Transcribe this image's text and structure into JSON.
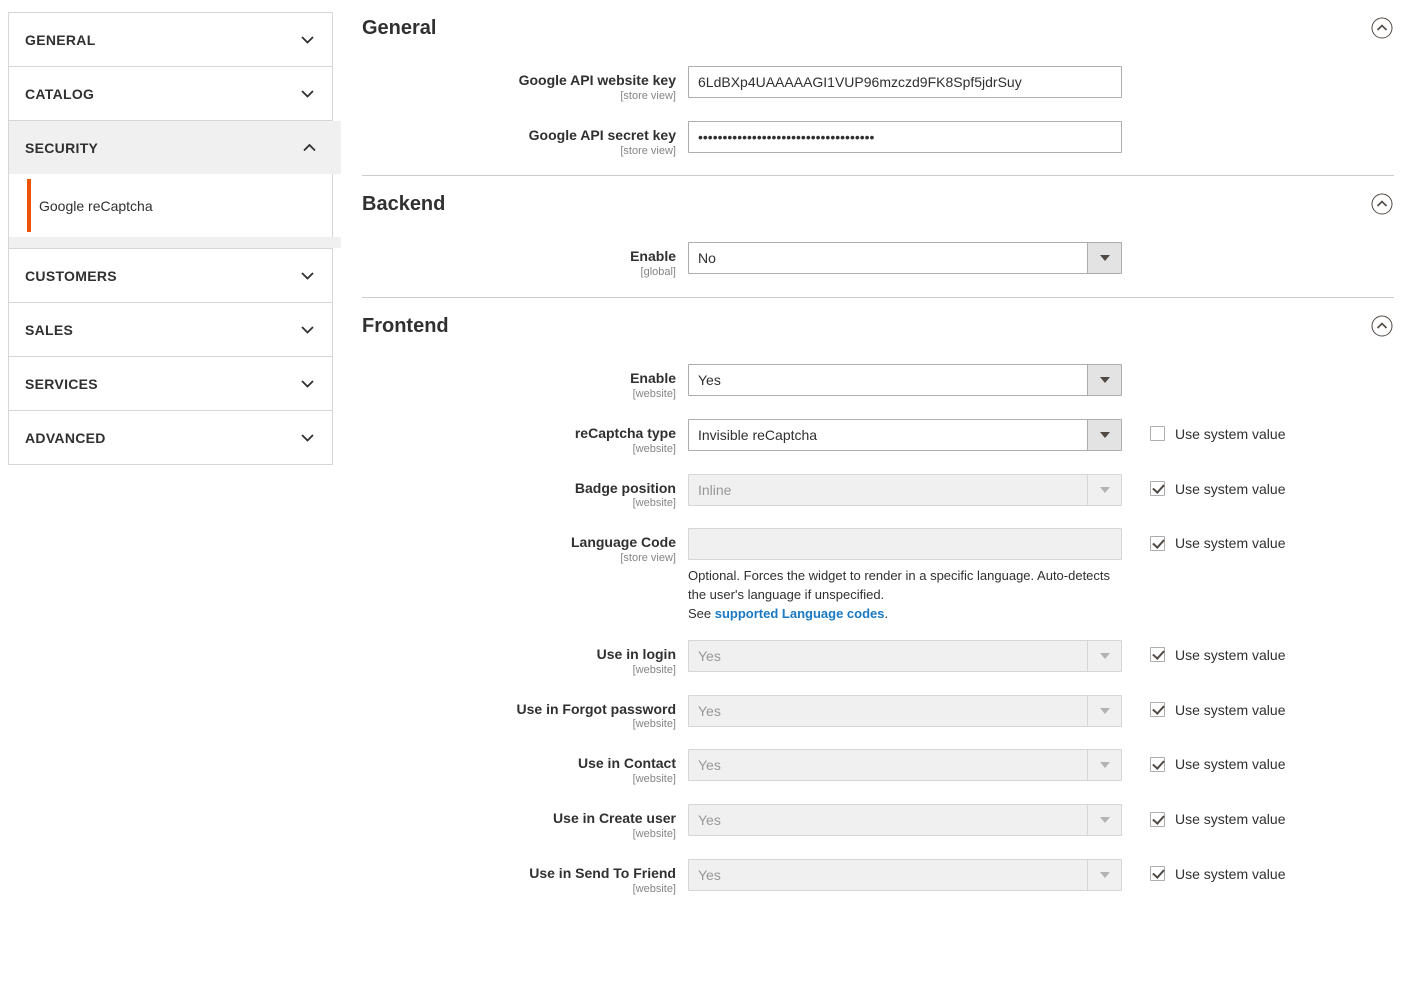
{
  "sidebar": {
    "sections": [
      {
        "label": "GENERAL",
        "expanded": false
      },
      {
        "label": "CATALOG",
        "expanded": false
      },
      {
        "label": "SECURITY",
        "expanded": true
      },
      {
        "label": "CUSTOMERS",
        "expanded": false
      },
      {
        "label": "SALES",
        "expanded": false
      },
      {
        "label": "SERVICES",
        "expanded": false
      },
      {
        "label": "ADVANCED",
        "expanded": false
      }
    ],
    "security_items": [
      {
        "label": "Google reCaptcha",
        "current": true
      }
    ]
  },
  "accent_color": "#eb5202",
  "link_color": "#1979c3",
  "groups": {
    "general": {
      "title": "General",
      "rows": {
        "website_key": {
          "label": "Google API website key",
          "scope": "[store view]",
          "value": "6LdBXp4UAAAAAGI1VUP96mzczd9FK8Spf5jdrSuy"
        },
        "secret_key": {
          "label": "Google API secret key",
          "scope": "[store view]",
          "value": "••••••••••••••••••••••••••••••••••••"
        }
      }
    },
    "backend": {
      "title": "Backend",
      "rows": {
        "enable": {
          "label": "Enable",
          "scope": "[global]",
          "value": "No"
        }
      }
    },
    "frontend": {
      "title": "Frontend",
      "sysval_label": "Use system value",
      "rows": {
        "enable": {
          "label": "Enable",
          "scope": "[website]",
          "value": "Yes"
        },
        "recaptcha_type": {
          "label": "reCaptcha type",
          "scope": "[website]",
          "value": "Invisible reCaptcha",
          "sysval_label": "Use system value"
        },
        "badge_position": {
          "label": "Badge position",
          "scope": "[website]",
          "value": "Inline",
          "sysval_label": "Use system value"
        },
        "language_code": {
          "label": "Language Code",
          "scope": "[store view]",
          "value": "",
          "sysval_label": "Use system value",
          "note_line1": "Optional. Forces the widget to render in a specific language. Auto-detects the user's language if unspecified.",
          "note_see": "See ",
          "note_link": "supported Language codes",
          "note_end": "."
        },
        "use_in_login": {
          "label": "Use in login",
          "scope": "[website]",
          "value": "Yes",
          "sysval_label": "Use system value"
        },
        "use_in_forgot_password": {
          "label": "Use in Forgot password",
          "scope": "[website]",
          "value": "Yes",
          "sysval_label": "Use system value"
        },
        "use_in_contact": {
          "label": "Use in Contact",
          "scope": "[website]",
          "value": "Yes",
          "sysval_label": "Use system value"
        },
        "use_in_create_user": {
          "label": "Use in Create user",
          "scope": "[website]",
          "value": "Yes",
          "sysval_label": "Use system value"
        },
        "use_in_send_to_friend": {
          "label": "Use in Send To Friend",
          "scope": "[website]",
          "value": "Yes",
          "sysval_label": "Use system value"
        }
      }
    }
  }
}
